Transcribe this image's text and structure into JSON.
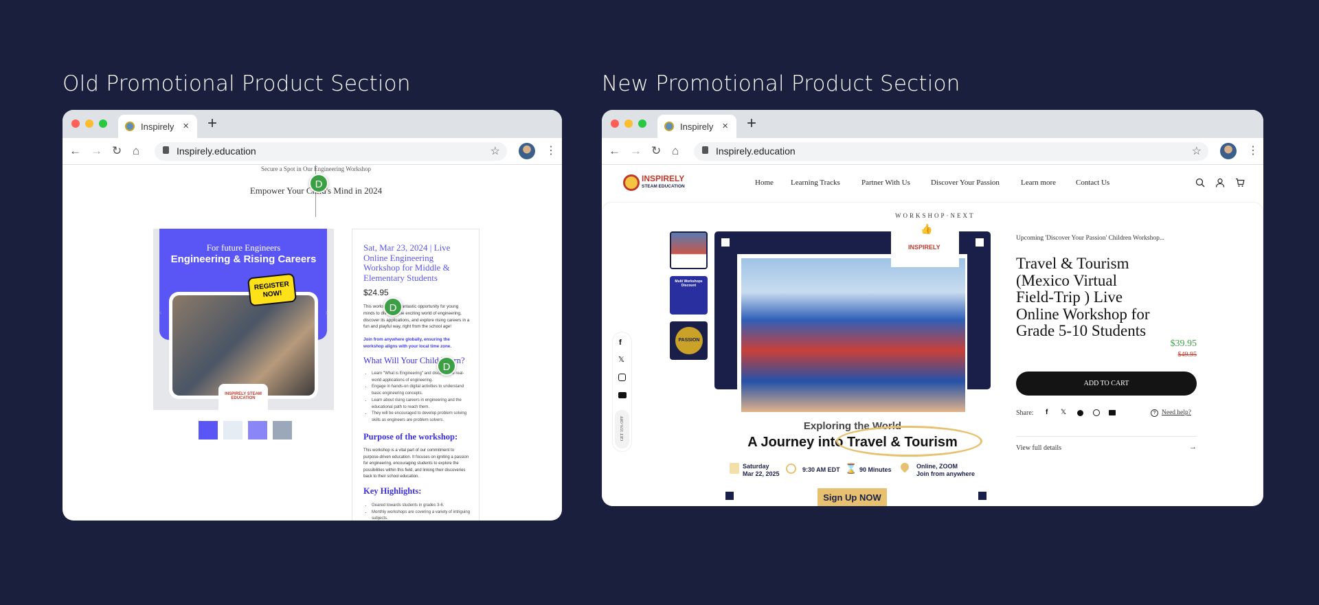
{
  "headings": {
    "old": "Old Promotional Product Section",
    "new": "New Promotional Product Section"
  },
  "browser": {
    "tab_title": "Inspirely",
    "close": "×",
    "new_tab": "+",
    "url": "Inspirely.education",
    "back": "←",
    "forward": "→",
    "reload": "↻",
    "home": "⌂",
    "star": "☆",
    "menu": "⋮"
  },
  "colors": {
    "background": "#1a1f3d",
    "accent_blue": "#5a55f5",
    "price_green": "#3aa043",
    "cta_black": "#141414",
    "signup_gold": "#e8c170",
    "frame_navy": "#1a1f4a"
  },
  "old": {
    "kicker": "Secure a Spot in Our Engineering Workshop",
    "headline": "Empower Your Child's Mind in 2024",
    "annotation_badge": "D",
    "banner": {
      "line1": "For future Engineers",
      "line2": "Engineering & Rising Careers",
      "sticker": "REGISTER NOW!",
      "logo": "INSPIRELY STEAM EDUCATION"
    },
    "title": "Sat, Mar 23, 2024 | Live Online Engineering Workshop for Middle & Elementary Students",
    "price": "$24.95",
    "intro": "This workshop is a fantastic opportunity for young minds to dive into the exciting world of engineering, discover its applications, and explore rising careers in a fun and playful way, right from the school age!",
    "join_note": "Join from anywhere globally, ensuring the workshop aligns with your local time zone.",
    "learn_heading": "What Will Your Child Learn?",
    "learn_items": [
      "Learn \"What is Engineering\" and discover the real-world applications of engineering.",
      "Engage in hands-on digital activities to understand basic engineering concepts.",
      "Learn about rising careers in engineering and the educational path to reach them.",
      "They will be encouraged to develop problem solving skills as engineers are problem solvers."
    ],
    "purpose_heading": "Purpose of the workshop:",
    "purpose_text": "This workshop is a vital part of our commitment to purpose-driven education. It focuses on igniting a passion for engineering, encouraging students to explore the possibilities within this field, and linking their discoveries back to their school education.",
    "highlights_heading": "Key Highlights:",
    "highlights": [
      "Geared towards students in grades 3-6.",
      "Monthly workshops are covering a variety of intriguing subjects."
    ]
  },
  "new": {
    "logo": {
      "name": "INSPIRELY",
      "sub": "STEAM EDUCATION"
    },
    "nav": [
      "Home",
      "Learning Tracks",
      "Partner With Us",
      "Discover Your Passion",
      "Learn more",
      "Contact Us"
    ],
    "sticker_text": "WORKSHOP·NEXT",
    "sticker_logo": "INSPIRELY",
    "thumb_labels": [
      "Multi Workshops Discount",
      "PASSION"
    ],
    "poster": {
      "kicker": "Exploring the World",
      "title_a": "A Journey into ",
      "title_b": "Travel & Tourism",
      "day": "Saturday",
      "date": "Mar 22, 2025",
      "time": "9:30 AM EDT",
      "duration": "90 Minutes",
      "location": "Online, ZOOM",
      "location_sub": "Join from anywhere",
      "cta": "Sign Up NOW"
    },
    "social": [
      "facebook-icon",
      "x-icon",
      "instagram-icon",
      "youtube-icon"
    ],
    "discount_tab": "GET 15% OFF",
    "eyebrow": "Upcoming 'Discover Your Passion' Children Workshop...",
    "title": "Travel & Tourism (Mexico Virtual Field-Trip ) Live Online Workshop for Grade 5-10 Students",
    "price": "$39.95",
    "compare_price": "$49.95",
    "add_to_cart": "ADD TO CART",
    "share_label": "Share:",
    "need_help": "Need help?",
    "view_details": "View full details",
    "arrow": "→"
  }
}
